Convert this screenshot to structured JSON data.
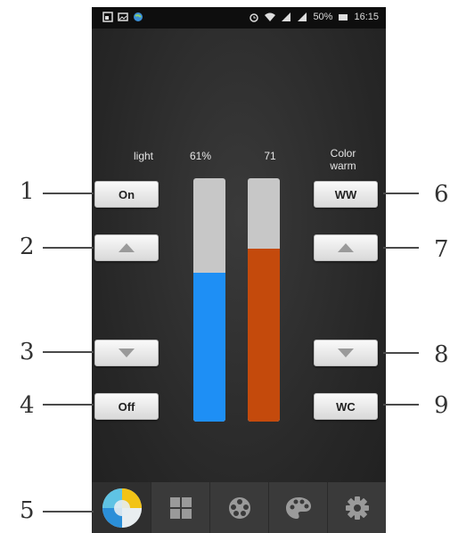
{
  "statusbar": {
    "battery_text": "50%",
    "time": "16:15"
  },
  "labels": {
    "light": "light",
    "brightness_value": "61%",
    "warmth_value": "71",
    "color_line1": "Color",
    "color_line2": "warm"
  },
  "buttons": {
    "on": "On",
    "off": "Off",
    "ww": "WW",
    "wc": "WC"
  },
  "bars": {
    "brightness": {
      "percent": 61,
      "color": "#1e8ff5"
    },
    "warmth": {
      "percent": 71,
      "color": "#c44a0c"
    }
  },
  "nav": {
    "items": [
      "color-wheel-icon",
      "grid-icon",
      "film-reel-icon",
      "palette-icon",
      "gear-icon"
    ]
  },
  "callouts": [
    "1",
    "2",
    "3",
    "4",
    "5",
    "6",
    "7",
    "8",
    "9"
  ]
}
